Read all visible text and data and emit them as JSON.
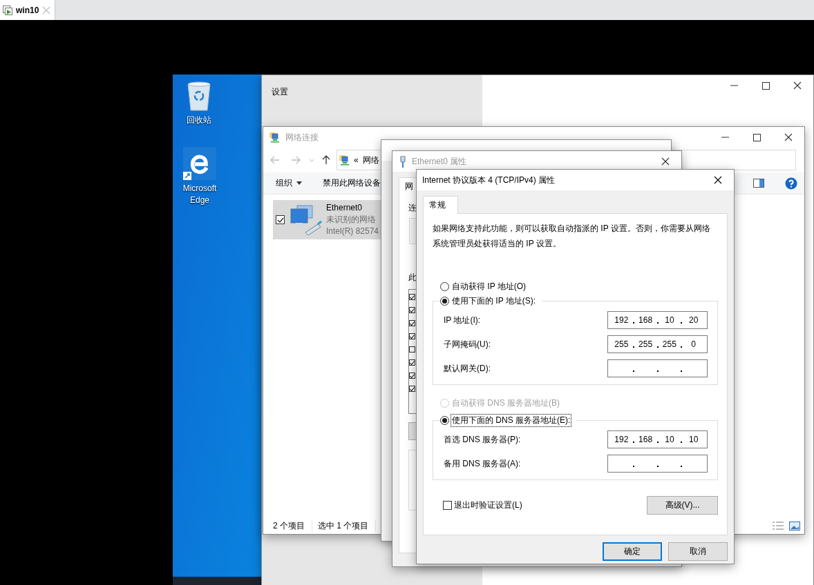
{
  "vm_tab": {
    "title": "win10"
  },
  "desktop_icons": [
    {
      "kind": "recycle",
      "label": "回收站"
    },
    {
      "kind": "edge",
      "label": "Microsoft Edge"
    }
  ],
  "settings_window": {
    "title": "设置"
  },
  "network_window": {
    "title": "网络连接",
    "breadcrumb_prefix": "«",
    "breadcrumb": "网络",
    "toolbar": [
      {
        "label": "组织",
        "dropdown": true
      },
      {
        "label": "禁用此网络设备",
        "dropdown": false
      }
    ],
    "connections": [
      {
        "name": "Ethernet0",
        "status": "未识别的网络",
        "adapter": "Intel(R) 82574",
        "selected": true,
        "checked": true
      }
    ],
    "status_bar": [
      "2 个项目",
      "选中 1 个项目"
    ]
  },
  "status_window": {
    "kind": "window"
  },
  "properties_window": {
    "title": "Ethernet0 属性",
    "tab": "网",
    "connect_label": "连",
    "items_label": "此",
    "items": [
      {
        "checked": true
      },
      {
        "checked": true
      },
      {
        "checked": true
      },
      {
        "checked": true
      },
      {
        "checked": false
      },
      {
        "checked": true
      },
      {
        "checked": true
      },
      {
        "checked": true
      }
    ]
  },
  "ipv4_dialog": {
    "title": "Internet 协议版本 4 (TCP/IPv4) 属性",
    "tab": "常规",
    "description": "如果网络支持此功能，则可以获取自动指派的 IP 设置。否则，你需要从网络系统管理员处获得适当的 IP 设置。",
    "ip_options": [
      {
        "label": "自动获得 IP 地址(O)",
        "selected": false,
        "disabled": false,
        "focused": false
      },
      {
        "label": "使用下面的 IP 地址(S):",
        "selected": true,
        "disabled": false,
        "focused": false
      }
    ],
    "ip_fields": [
      {
        "label": "IP 地址(I):",
        "octets": [
          "192",
          "168",
          "10",
          "20"
        ]
      },
      {
        "label": "子网掩码(U):",
        "octets": [
          "255",
          "255",
          "255",
          "0"
        ]
      },
      {
        "label": "默认网关(D):"
      }
    ],
    "dns_options": [
      {
        "label": "自动获得 DNS 服务器地址(B)",
        "selected": false,
        "disabled": true,
        "focused": false
      },
      {
        "label": "使用下面的 DNS 服务器地址(E):",
        "selected": true,
        "disabled": false,
        "focused": true
      }
    ],
    "dns_fields": [
      {
        "label": "首选 DNS 服务器(P):",
        "octets": [
          "192",
          "168",
          "10",
          "10"
        ]
      },
      {
        "label": "备用 DNS 服务器(A):"
      }
    ],
    "validate_on_exit": {
      "label": "退出时验证设置(L)",
      "checked": false
    },
    "advanced_button": "高级(V)...",
    "buttons": [
      {
        "label": "确定",
        "default": true
      },
      {
        "label": "取消",
        "default": false
      }
    ]
  }
}
